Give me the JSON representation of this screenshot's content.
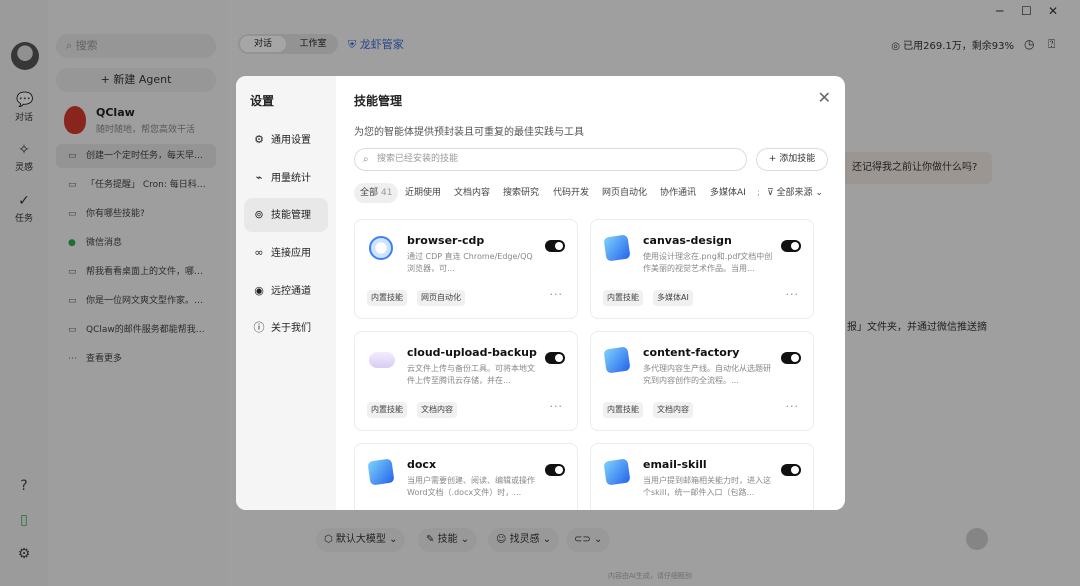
{
  "app": {
    "rail": [
      {
        "label": "对话",
        "icon": "chat-bubble-icon"
      },
      {
        "label": "灵感",
        "icon": "sparkle-icon"
      },
      {
        "label": "任务",
        "icon": "check-circle-icon"
      }
    ],
    "search_placeholder": "搜索",
    "new_agent_label": "+ 新建 Agent",
    "qclaw": {
      "name": "QClaw",
      "subtitle": "随时随地，帮您高效干活"
    },
    "conversations": [
      "创建一个定时任务，每天早…",
      "「任务提醒」 Cron: 每日科…",
      "你有哪些技能?",
      "微信消息",
      "帮我看看桌面上的文件，哪…",
      "你是一位网文爽文型作家。…",
      "QClaw的邮件服务都能帮我…",
      "查看更多"
    ],
    "tabs": [
      "对话",
      "工作室"
    ],
    "butler_label": "龙虾管家",
    "usage_text": "已用269.1万，剩余93%",
    "chat_bubble": "还记得我之前让你做什么吗?",
    "chat_line": "报」文件夹，并通过微信推送摘",
    "composer": {
      "model": "默认大模型",
      "skills": "技能",
      "inspire": "找灵感"
    },
    "footer_note": "内容由AI生成，请仔细甄别"
  },
  "modal": {
    "nav_title": "设置",
    "nav_items": [
      {
        "label": "通用设置",
        "icon": "gear-icon"
      },
      {
        "label": "用量统计",
        "icon": "chart-line-icon"
      },
      {
        "label": "技能管理",
        "icon": "brain-icon"
      },
      {
        "label": "连接应用",
        "icon": "link-icon"
      },
      {
        "label": "远控通道",
        "icon": "remote-icon"
      },
      {
        "label": "关于我们",
        "icon": "info-icon"
      }
    ],
    "active_nav": "技能管理",
    "title": "技能管理",
    "description": "为您的智能体提供预封装且可重复的最佳实践与工具",
    "search_placeholder": "搜索已经安装的技能",
    "add_skill_label": "+ 添加技能",
    "filters": [
      "全部",
      "近期使用",
      "文档内容",
      "搜索研究",
      "代码开发",
      "网页自动化",
      "协作通讯",
      "多媒体AI"
    ],
    "filter_all_count": "41",
    "source_filter": "全部来源",
    "skills": [
      {
        "name": "browser-cdp",
        "desc": "通过 CDP 直连 Chrome/Edge/QQ浏览器，可…",
        "tags": [
          "内置技能",
          "网页自动化"
        ],
        "icon": "globe-icon",
        "enabled": true
      },
      {
        "name": "canvas-design",
        "desc": "使用设计理念在.png和.pdf文档中创作美丽的视觉艺术作品。当用…",
        "tags": [
          "内置技能",
          "多媒体AI"
        ],
        "icon": "puzzle-icon",
        "enabled": true
      },
      {
        "name": "cloud-upload-backup",
        "desc": "云文件上传与备份工具。可将本地文件上传至腾讯云存储，并在…",
        "tags": [
          "内置技能",
          "文档内容"
        ],
        "icon": "cloud-icon",
        "enabled": true
      },
      {
        "name": "content-factory",
        "desc": "多代理内容生产线。自动化从选题研究到内容创作的全流程。…",
        "tags": [
          "内置技能",
          "文档内容"
        ],
        "icon": "puzzle-icon",
        "enabled": true
      },
      {
        "name": "docx",
        "desc": "当用户需要创建、阅读、编辑或操作Word文档（.docx文件）时，…",
        "tags": [],
        "icon": "puzzle-icon",
        "enabled": true
      },
      {
        "name": "email-skill",
        "desc": "当用户提到邮箱相关能力时，进入这个skill，统一邮件入口（包路…",
        "tags": [],
        "icon": "puzzle-icon",
        "enabled": true
      }
    ]
  }
}
